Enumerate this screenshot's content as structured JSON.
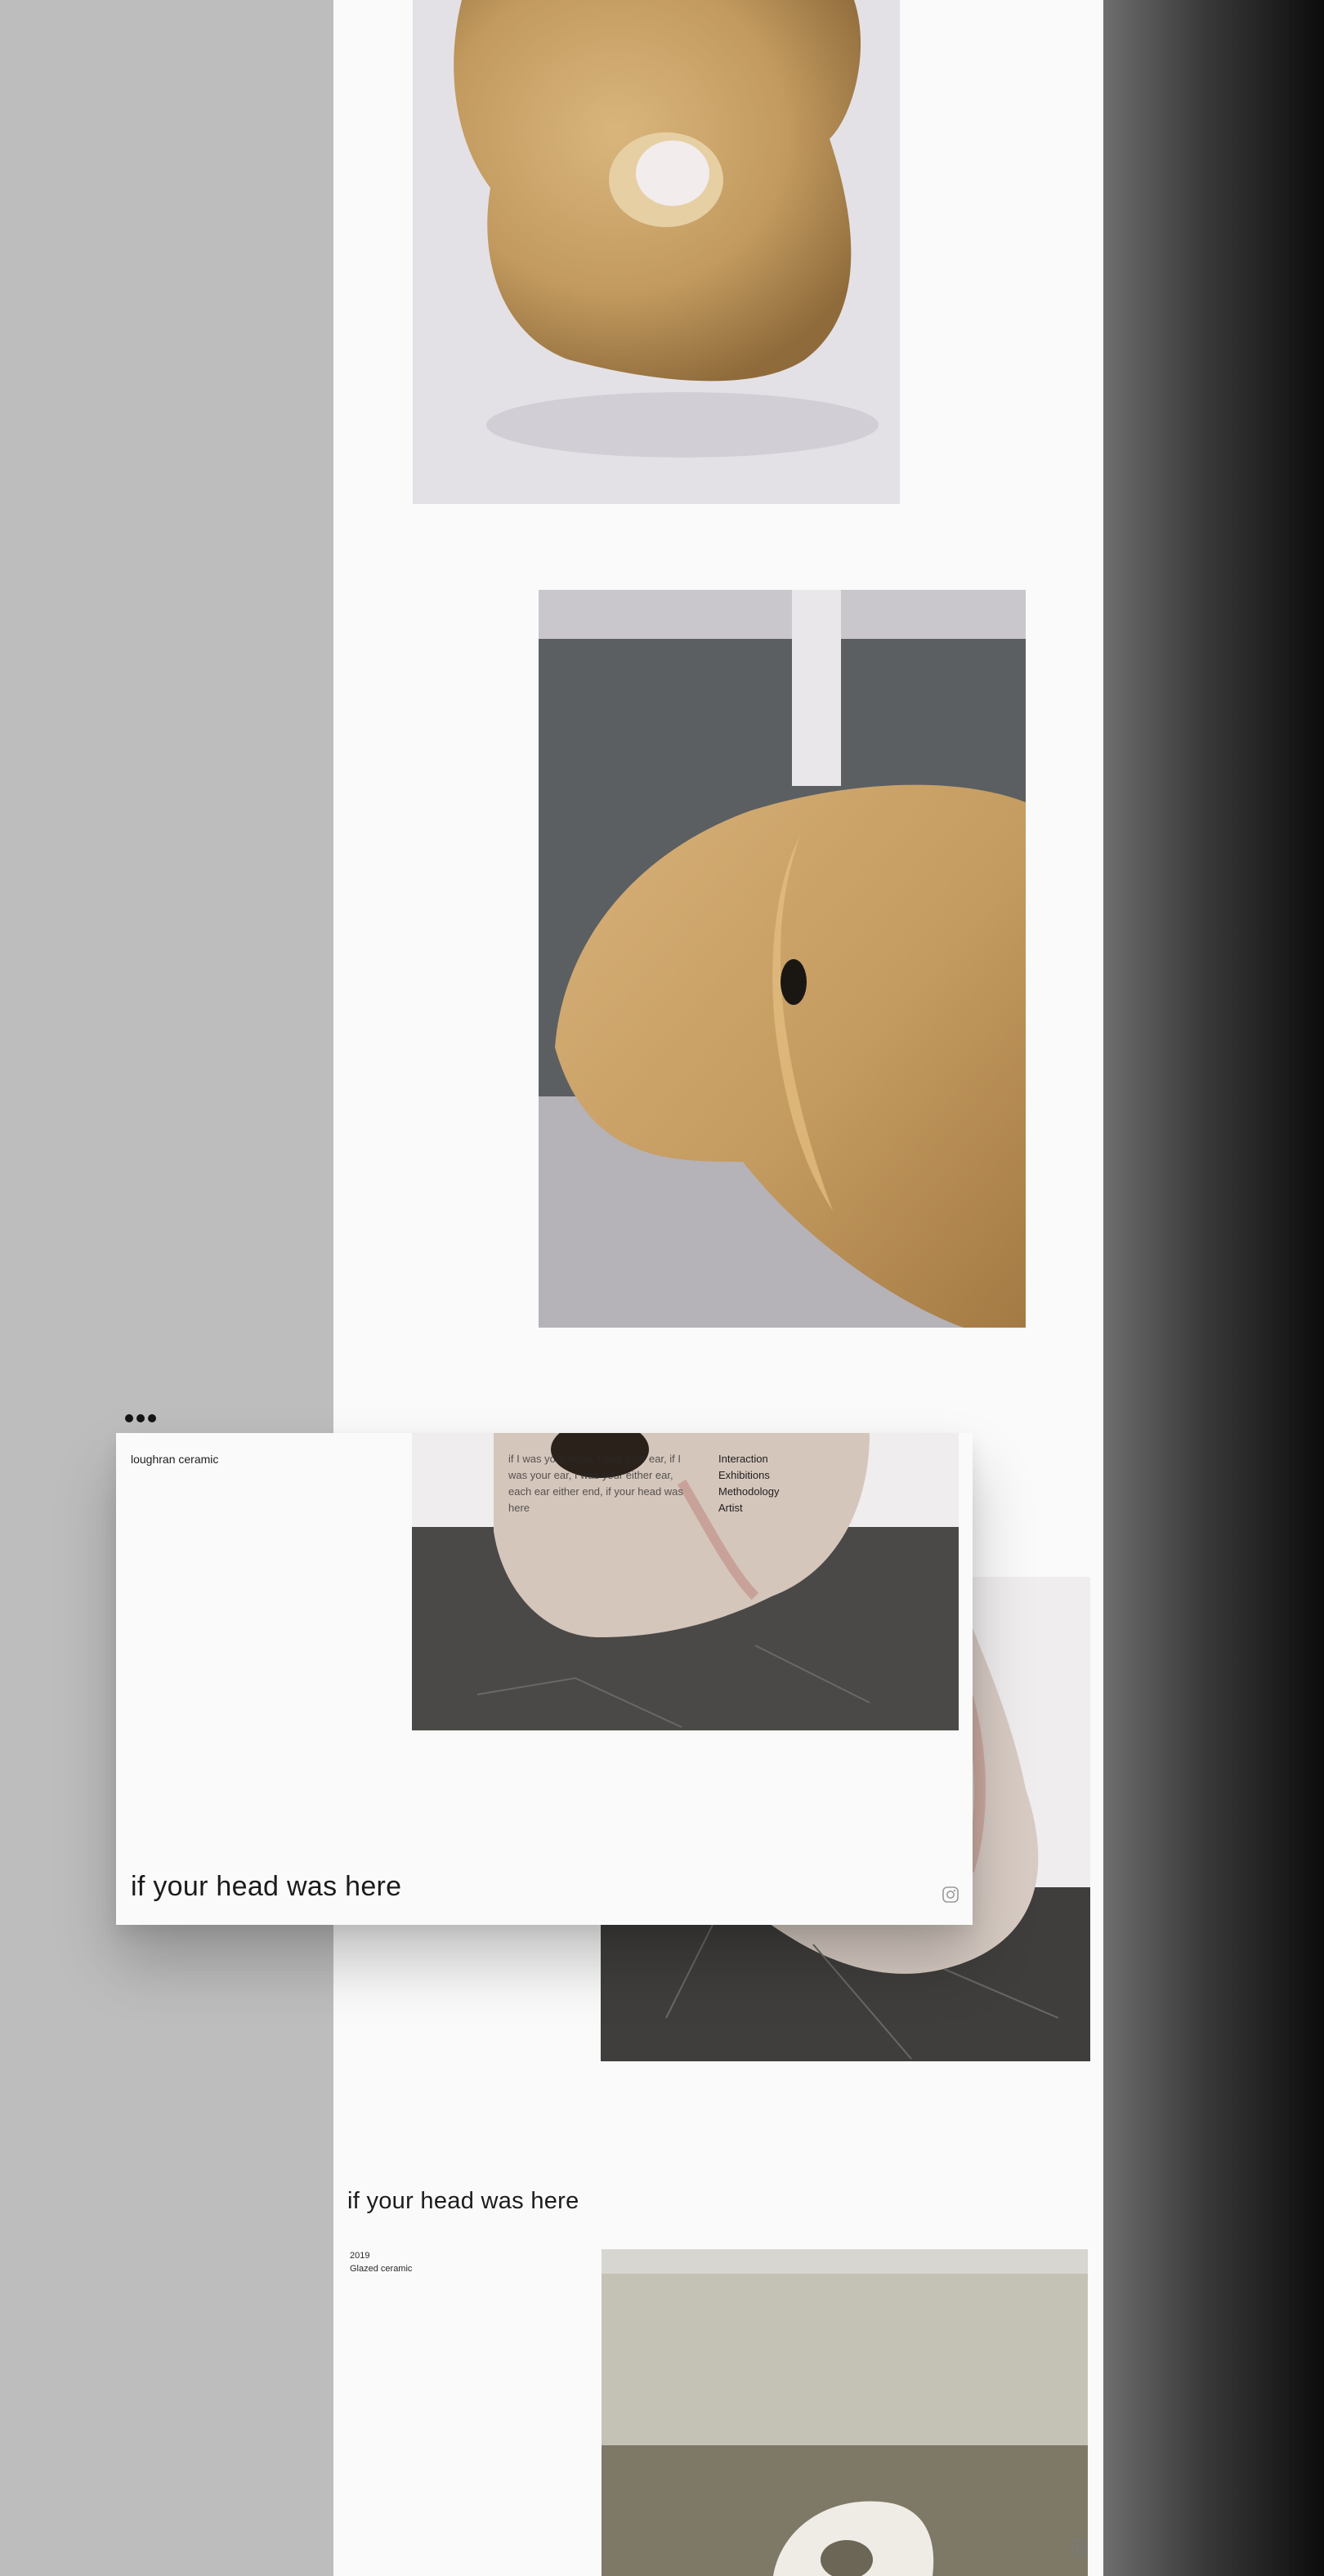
{
  "site": {
    "brand": "loughran ceramic",
    "intro_text": "if I was your head, I was your ear, if I was your ear, I was your either ear, each ear either end, if your head was here"
  },
  "nav": {
    "items": [
      "Interaction",
      "Exhibitions",
      "Methodology",
      "Artist"
    ]
  },
  "overlay": {
    "title": "if your head was here"
  },
  "project": {
    "title": "if your head was here",
    "year": "2019",
    "material": "Glazed ceramic"
  },
  "icons": {
    "menu": "ellipsis-icon",
    "social": "instagram-icon"
  },
  "colors": {
    "page_background": "#f9faf9",
    "side_background": "#bdbdbd",
    "ceramic_tan": "#c9a46a",
    "ceramic_pink": "#d8bfb2",
    "text": "#1b1b1b"
  }
}
